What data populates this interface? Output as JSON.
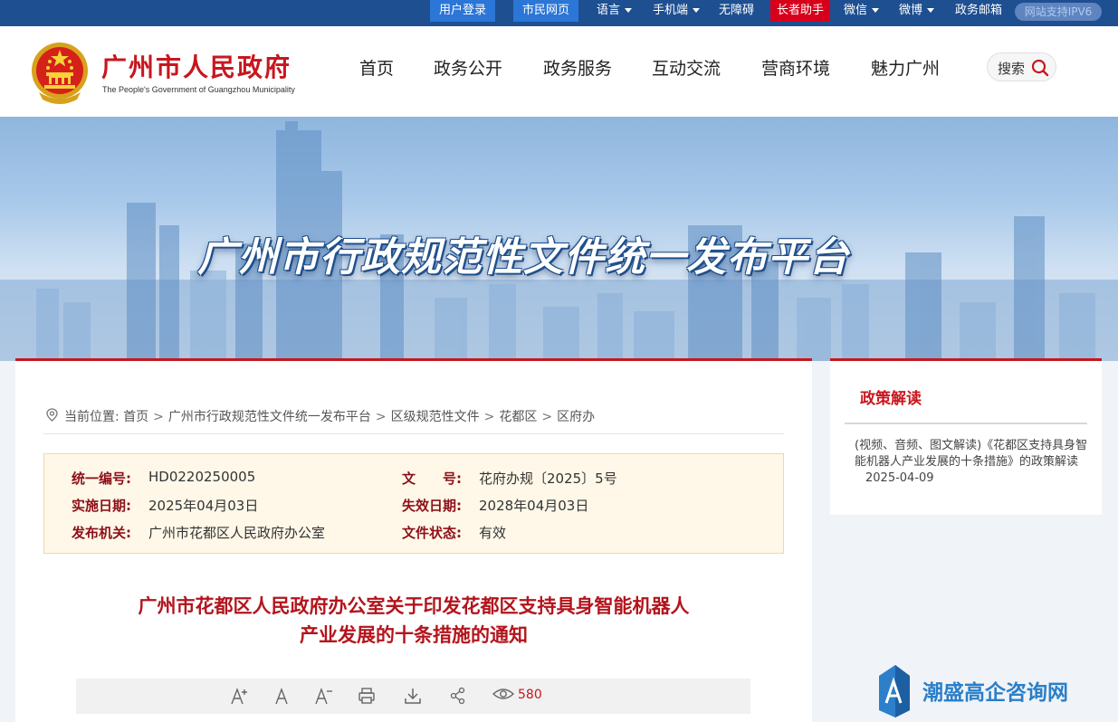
{
  "topbar": {
    "login": "用户登录",
    "citizen_page": "市民网页",
    "language": "语言",
    "mobile": "手机端",
    "accessibility": "无障碍",
    "elder_helper": "长者助手",
    "wechat": "微信",
    "weibo": "微博",
    "gov_mail": "政务邮箱",
    "ipv6": "网站支持IPV6"
  },
  "header": {
    "title": "广州市人民政府",
    "subtitle": "The People's Government of Guangzhou Municipality",
    "nav": [
      "首页",
      "政务公开",
      "政务服务",
      "互动交流",
      "营商环境",
      "魅力广州"
    ],
    "search_label": "搜索"
  },
  "banner": {
    "title": "广州市行政规范性文件统一发布平台"
  },
  "breadcrumb": {
    "prefix": "当前位置:",
    "items": [
      "首页",
      "广州市行政规范性文件统一发布平台",
      "区级规范性文件",
      "花都区",
      "区府办"
    ]
  },
  "meta": {
    "code_label": "统一编号:",
    "code_value": "HD0220250005",
    "docno_label": "文　　号:",
    "docno_value": "花府办规〔2025〕5号",
    "effective_label": "实施日期:",
    "effective_value": "2025年04月03日",
    "expire_label": "失效日期:",
    "expire_value": "2028年04月03日",
    "issuer_label": "发布机关:",
    "issuer_value": "广州市花都区人民政府办公室",
    "status_label": "文件状态:",
    "status_value": "有效"
  },
  "document": {
    "title_line1": "广州市花都区人民政府办公室关于印发花都区支持具身智能机器人",
    "title_line2": "产业发展的十条措施的通知"
  },
  "toolbar": {
    "font_larger": "A+",
    "font_normal": "A",
    "font_smaller": "A-",
    "views": "580"
  },
  "side": {
    "title": "政策解读",
    "item_text": "(视频、音频、图文解读)《花都区支持具身智能机器人产业发展的十条措施》的政策解读",
    "item_date": "2025-04-09"
  },
  "watermark": {
    "text": "潮盛高企咨询网"
  }
}
